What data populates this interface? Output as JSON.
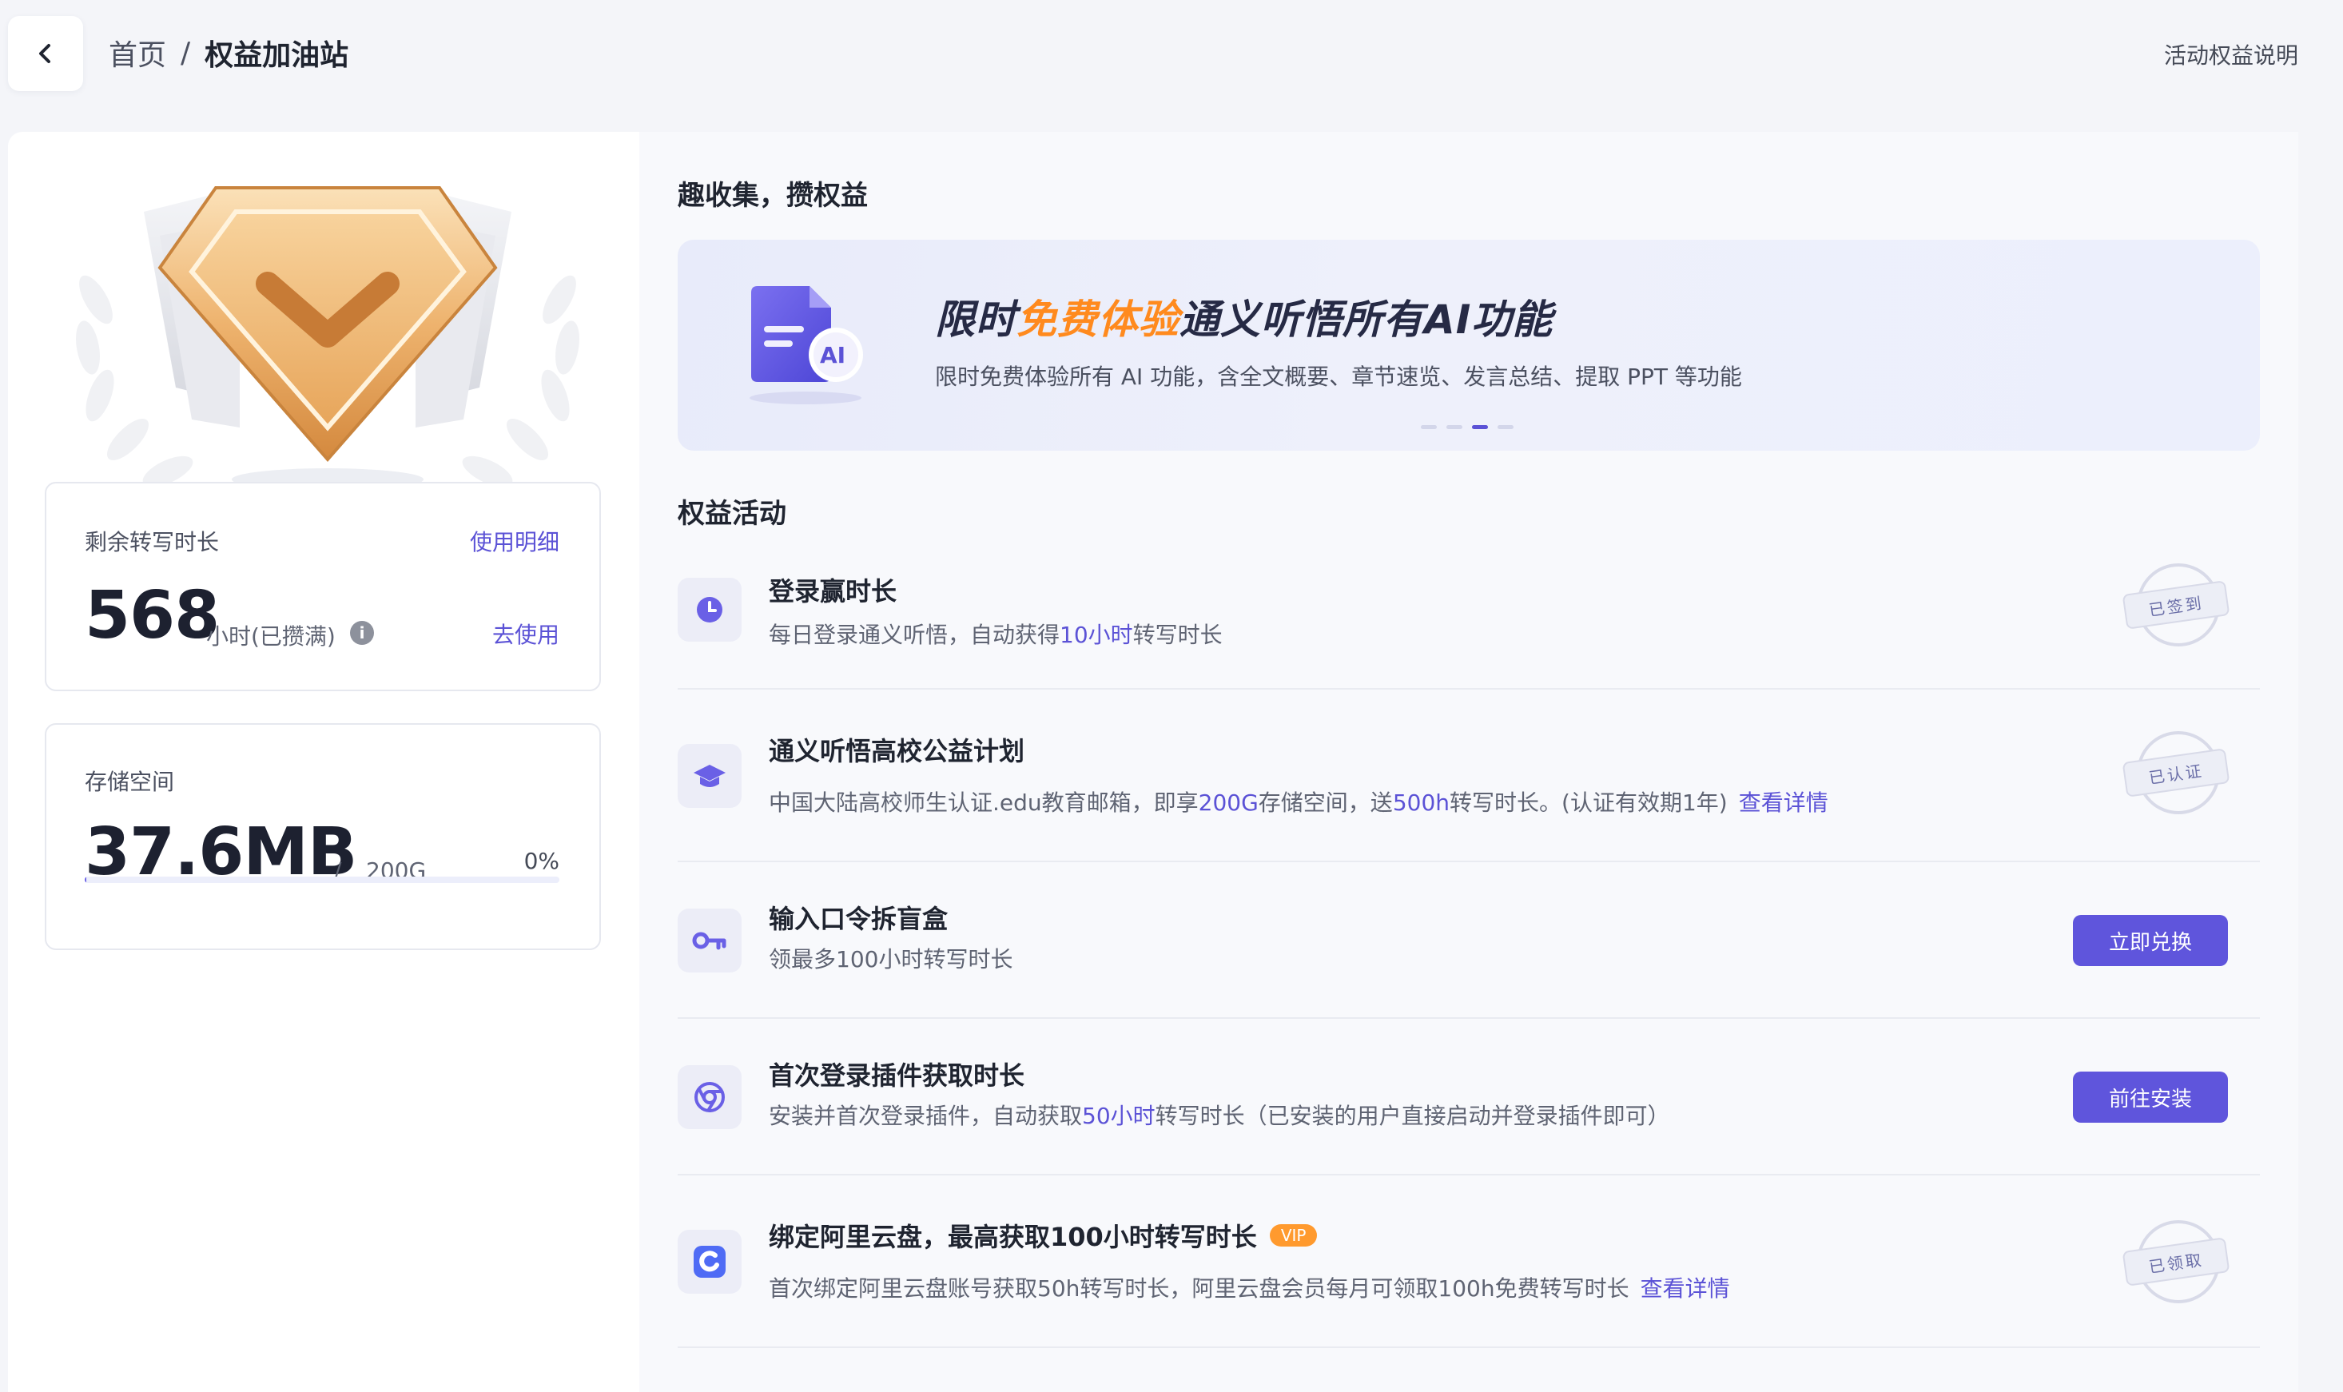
{
  "header": {
    "breadcrumb_home": "首页",
    "breadcrumb_sep": "/",
    "breadcrumb_current": "权益加油站",
    "help_link": "活动权益说明"
  },
  "hours_card": {
    "label": "剩余转写时长",
    "detail_link": "使用明细",
    "value": "568",
    "unit": "小时(已攒满)",
    "use_link": "去使用"
  },
  "storage_card": {
    "label": "存储空间",
    "used": "37.6MB",
    "sep": "/",
    "total": "200G",
    "percent": "0%",
    "progress_fraction": 0.003
  },
  "collect": {
    "title": "趣收集，攒权益"
  },
  "banner": {
    "title_part1": "限时",
    "title_highlight": "免费体验",
    "title_part2": "通义听悟所有AI功能",
    "subtitle": "限时免费体验所有 AI 功能，含全文概要、章节速览、发言总结、提取 PPT 等功能",
    "doc_label": "AI",
    "active_dot": 2,
    "dot_count": 4
  },
  "activities": {
    "title": "权益活动",
    "items": [
      {
        "icon": "clock-icon",
        "title": "登录赢时长",
        "desc_before": "每日登录通义听悟，自动获得",
        "desc_em": "10小时",
        "desc_after": "转写时长",
        "stamp": "已签到"
      },
      {
        "icon": "graduation-cap-icon",
        "title": "通义听悟高校公益计划",
        "desc_a": "中国大陆高校师生认证.edu教育邮箱，即享",
        "desc_em1": "200G",
        "desc_b": "存储空间，送",
        "desc_em2": "500h",
        "desc_c": "转写时长。(认证有效期1年)",
        "link": "查看详情",
        "stamp": "已认证"
      },
      {
        "icon": "key-icon",
        "title": "输入口令拆盲盒",
        "desc": "领最多100小时转写时长",
        "button": "立即兑换"
      },
      {
        "icon": "browser-plugin-icon",
        "title": "首次登录插件获取时长",
        "desc_before": "安装并首次登录插件，自动获取",
        "desc_em": "50小时",
        "desc_after": "转写时长（已安装的用户直接启动并登录插件即可）",
        "button": "前往安装"
      },
      {
        "icon": "aliyun-drive-icon",
        "title": "绑定阿里云盘，最高获取100小时转写时长",
        "vip": "VIP",
        "desc": "首次绑定阿里云盘账号获取50h转写时长，阿里云盘会员每月可领取100h免费转写时长",
        "link": "查看详情",
        "stamp": "已领取"
      }
    ]
  },
  "colors": {
    "accent": "#5f55dc",
    "highlight": "#ff8a1e",
    "vip": "#ff9a2e"
  }
}
